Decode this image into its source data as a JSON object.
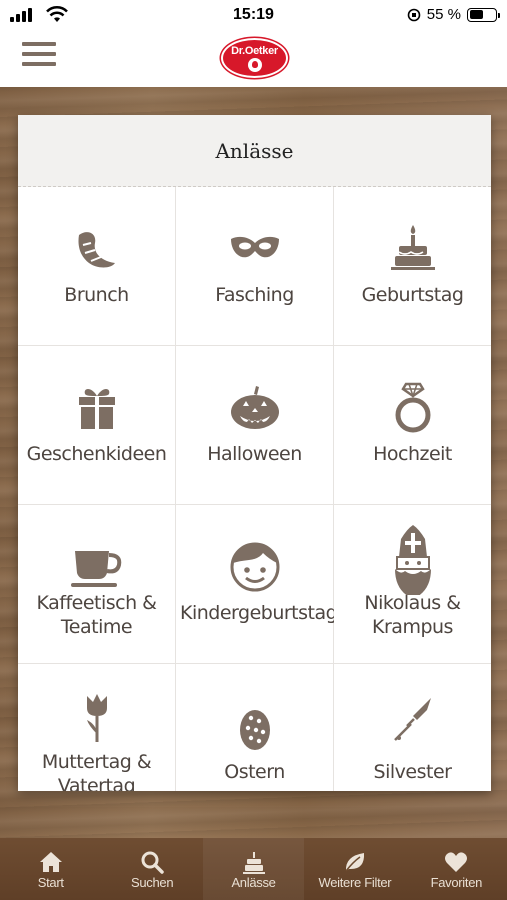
{
  "status_bar": {
    "time": "15:19",
    "battery": "55 %",
    "battery_level": 0.55
  },
  "header": {
    "menu_icon": "hamburger-menu-icon",
    "logo_text": "Dr.Oetker"
  },
  "card": {
    "title": "Anlässe",
    "items": [
      {
        "label": "Brunch",
        "icon": "croissant-icon"
      },
      {
        "label": "Fasching",
        "icon": "carnival-mask-icon"
      },
      {
        "label": "Geburtstag",
        "icon": "birthday-cake-icon"
      },
      {
        "label": "Geschenkideen",
        "icon": "gift-icon"
      },
      {
        "label": "Halloween",
        "icon": "pumpkin-icon"
      },
      {
        "label": "Hochzeit",
        "icon": "ring-icon"
      },
      {
        "label": "Kaffeetisch & Teatime",
        "line1": "Kaffeetisch &",
        "line2": "Teatime",
        "icon": "coffee-cup-icon"
      },
      {
        "label": "Kindergeburtstag",
        "icon": "child-face-icon"
      },
      {
        "label": "Nikolaus & Krampus",
        "line1": "Nikolaus &",
        "line2": "Krampus",
        "icon": "saint-nicholas-icon"
      },
      {
        "label": "Muttertag & Vatertag",
        "line1": "Muttertag &",
        "line2": "Vatertag",
        "icon": "tulip-icon"
      },
      {
        "label": "Ostern",
        "icon": "easter-egg-icon"
      },
      {
        "label": "Silvester",
        "icon": "rocket-firework-icon"
      }
    ]
  },
  "tabbar": {
    "tabs": [
      {
        "label": "Start",
        "icon": "home-icon"
      },
      {
        "label": "Suchen",
        "icon": "search-icon"
      },
      {
        "label": "Anlässe",
        "icon": "cake-icon"
      },
      {
        "label": "Weitere Filter",
        "icon": "leaf-icon"
      },
      {
        "label": "Favoriten",
        "icon": "heart-icon"
      }
    ]
  },
  "colors": {
    "icon": "#7d6e63",
    "text": "#4d4540",
    "brand_red": "#d7182a",
    "tabbar": "#6d4b30"
  }
}
